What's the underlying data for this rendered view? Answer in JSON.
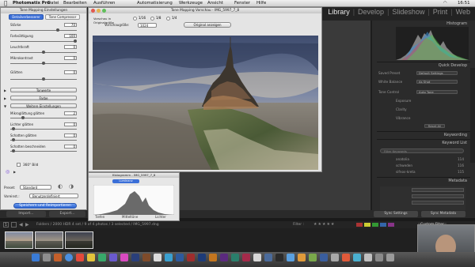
{
  "menubar": {
    "items": [
      "Photomatix Pro",
      "Datei",
      "Bearbeiten",
      "Ausführen",
      "Automatisierung",
      "Werkzeuge",
      "Ansicht",
      "Fenster",
      "Hilfe"
    ],
    "clock": "16:51"
  },
  "lightroom": {
    "modules": [
      "Library",
      "Develop",
      "Slideshow",
      "Print",
      "Web"
    ],
    "active_module": "Library",
    "right_panel": {
      "histogram_label": "Histogram",
      "quick_develop_label": "Quick Develop",
      "qd_rows": [
        {
          "label": "Saved Preset",
          "value": "Default Settings"
        },
        {
          "label": "White Balance",
          "value": "As Shot"
        },
        {
          "label": "Tone Control",
          "value": "Auto Tone"
        }
      ],
      "tone_rows": [
        "Exposure",
        "Clarity",
        "Vibrance"
      ],
      "reset_label": "Reset All",
      "keywording_label": "Keywording",
      "keyword_list_label": "Keyword List",
      "filter_placeholder": "Filter Keywords",
      "keywords": [
        {
          "name": "anatolia",
          "count": "114"
        },
        {
          "name": "schweden",
          "count": "116"
        },
        {
          "name": "sifnos-kreta",
          "count": "115"
        }
      ],
      "metadata_label": "Metadata",
      "sync_settings_label": "Sync Settings",
      "sync_metadata_label": "Sync Metadata"
    },
    "import_label": "Import...",
    "export_label": "Export...",
    "filmstrip_path": "Folders / 2000 HDR 4 set / 9 of 4 photos / 3 selected / IMG_5997.dng",
    "filter_label": "Filter :",
    "filter_value": "Custom Filter"
  },
  "photomatix": {
    "title": "Tone Mapping Einstellungen",
    "tabs": [
      "Detailverbesserer",
      "Tone Compressor"
    ],
    "sliders": [
      {
        "label": "Stärke",
        "value": "70"
      },
      {
        "label": "Farbsättigung",
        "value": "100"
      },
      {
        "label": "Leuchtkraft",
        "value": "0"
      },
      {
        "label": "Mikrokontrast",
        "value": "0"
      },
      {
        "label": "Glätten",
        "value": "0"
      }
    ],
    "collapsible": [
      "Tonwerte",
      "Farbe",
      "Weitere Einstellungen"
    ],
    "mini_rows": [
      {
        "label": "Mikroglättung glätten",
        "value": "2"
      },
      {
        "label": "Lichter glätten",
        "value": "0"
      },
      {
        "label": "Schatten glätten",
        "value": "0"
      },
      {
        "label": "Schatten beschneiden",
        "value": "0"
      }
    ],
    "checkbox_label": "360° Bild",
    "preset_label": "Preset:",
    "preset_value": "Standard",
    "settings_label": "Voreinst.:",
    "settings_value": "Benutzerdefiniert",
    "process_button": "Speichern und Reimportieren"
  },
  "preview": {
    "title": "Tone Mapping Vorschau - IMG_5997_7_8",
    "show_original_label": "Vorschaugröße:",
    "zoom_value": "1024",
    "original_button": "Original anzeigen",
    "ratio_labels": [
      "1/16",
      "1/8",
      "1/4"
    ],
    "preview_label": "Vorschau in Originalgröße"
  },
  "histogram_win": {
    "title": "Histogramm - IMG_5997_7_8",
    "tab": "Luminanz",
    "labels": [
      "Tiefen",
      "Mitteltöne",
      "Lichter"
    ]
  },
  "colors": {
    "lr_bg": "#2b2b2b",
    "accent_blue": "#3b6fd8",
    "panel_light": "#e8e8e8"
  }
}
